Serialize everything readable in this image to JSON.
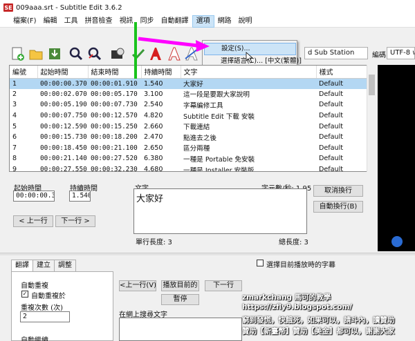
{
  "window": {
    "title": "009aaa.srt - Subtitle Edit 3.6.2",
    "app_icon_text": "SE"
  },
  "menu": [
    "檔案(F)",
    "編輯",
    "工具",
    "拼音檢查",
    "視訊",
    "同步",
    "自動翻譯",
    "選項",
    "網路",
    "說明"
  ],
  "menu_active_index": 7,
  "dropdown": {
    "items": [
      "設定(S)...",
      "選擇語言(C)... [中文(繁體)]"
    ],
    "highlighted_index": 0
  },
  "toolbar": {
    "format_value": "d Sub Station",
    "encoding_label": "編碼",
    "encoding_value": "UTF-8 w"
  },
  "grid": {
    "columns": [
      "編號",
      "起始時間",
      "結束時間",
      "持續時間",
      "文字",
      "樣式"
    ],
    "rows": [
      [
        "1",
        "00:00:00.370",
        "00:00:01.910",
        "1.540",
        "大家好",
        "Default"
      ],
      [
        "2",
        "00:00:02.070",
        "00:00:05.170",
        "3.100",
        "這一段是要跟大家說明",
        "Default"
      ],
      [
        "3",
        "00:00:05.190",
        "00:00:07.730",
        "2.540",
        "字幕編修工具",
        "Default"
      ],
      [
        "4",
        "00:00:07.750",
        "00:00:12.570",
        "4.820",
        "Subtitle Edit 下載 安裝",
        "Default"
      ],
      [
        "5",
        "00:00:12.590",
        "00:00:15.250",
        "2.660",
        "下載連結",
        "Default"
      ],
      [
        "6",
        "00:00:15.730",
        "00:00:18.200",
        "2.470",
        "點進去之後",
        "Default"
      ],
      [
        "7",
        "00:00:18.450",
        "00:00:21.100",
        "2.650",
        "區分兩種",
        "Default"
      ],
      [
        "8",
        "00:00:21.140",
        "00:00:27.520",
        "6.380",
        "一種是 Portable 免安裝",
        "Default"
      ],
      [
        "9",
        "00:00:27.550",
        "00:00:32.230",
        "4.680",
        "一種是 Installer 安裝版",
        "Default"
      ]
    ],
    "selected_index": 0
  },
  "edit": {
    "start_label": "起始時間",
    "duration_label": "持續時間",
    "start_value": "00:00:00.370",
    "duration_value": "1.540",
    "prev_button": "< 上一行",
    "next_button": "下一行 >",
    "text_label": "文字",
    "chars_per_sec": "字元數/秒: 1.95",
    "text_value": "大家好",
    "line_length": "單行長度: 3",
    "total_length": "總長度: 3",
    "unbreak_button": "取消換行",
    "autobreak_button": "自動換行(B)"
  },
  "video_check_label": "選擇目前播放時的字幕",
  "bottom_tabs": {
    "tabs": [
      "翻譯",
      "建立",
      "調整"
    ],
    "active_index": 0
  },
  "translate_panel": {
    "group_label": "自動重複",
    "auto_repeat_label": "自動重複於",
    "repeat_count_label": "重複次數 (次)",
    "repeat_count_value": "2",
    "continue_label": "自動繼續"
  },
  "playback": {
    "prev_button": "<上一行(V)",
    "play_current_button": "播放目前的",
    "next_button": "下一行",
    "pause_button": "暫停"
  },
  "search_online_label": "在網上搜尋文字",
  "watermark": [
    "zmarkchang 馬可的教學",
    "https://zfly9.blogspot.com/",
    "窮到發慌，快餓死，如果可以，請斗內，讀贊助",
    "贊助【新臺幣】贊助【美金】都可以，謝謝大家"
  ],
  "colors": {
    "selection": "#b3d7f3",
    "menu_highlight": "#cce4f7",
    "annotation_green": "#19c31c",
    "annotation_magenta": "#ff00ff",
    "app_icon": "#c62828"
  }
}
